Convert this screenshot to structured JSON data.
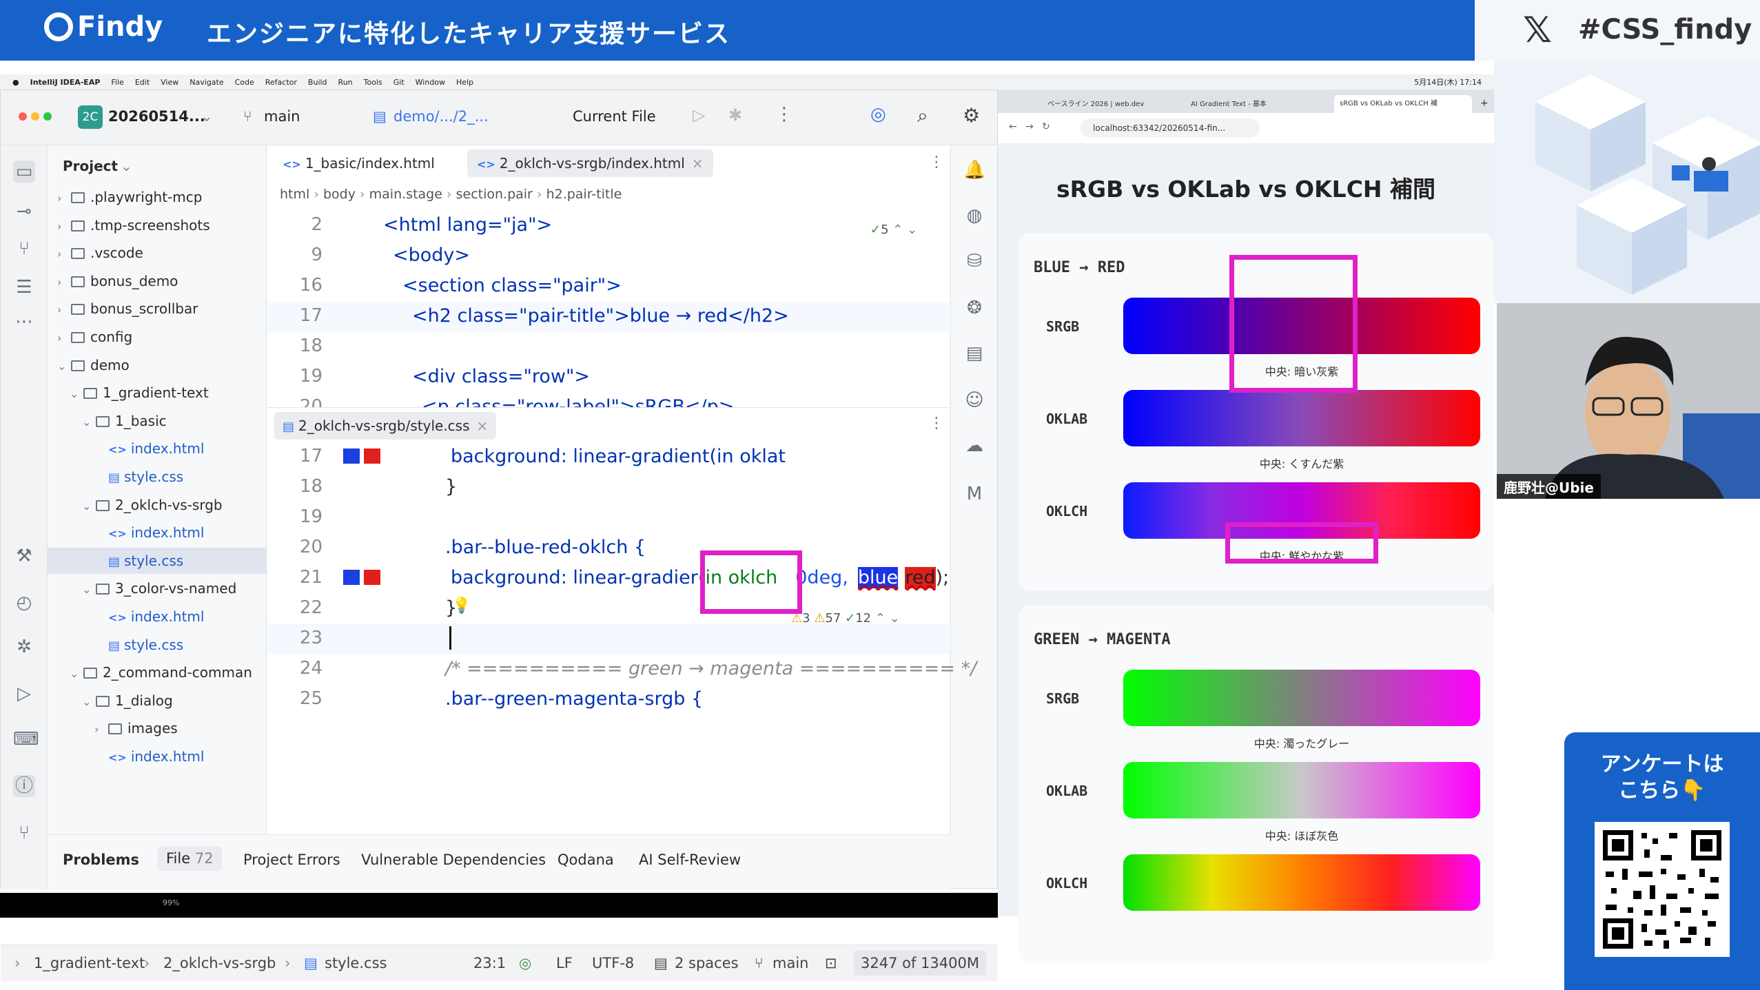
{
  "banner": {
    "brand": "Findy",
    "title": "エンジニアに特化したキャリア支援サービス",
    "hashtag": "#CSS_findy"
  },
  "mac_menu": {
    "app": "IntelliJ IDEA-EAP",
    "items": [
      "File",
      "Edit",
      "View",
      "Navigate",
      "Code",
      "Refactor",
      "Build",
      "Run",
      "Tools",
      "Git",
      "Window",
      "Help"
    ],
    "clock": "5月14日(木) 17:14"
  },
  "ide": {
    "project_badge": "2C",
    "project_name": "20260514...",
    "branch": "main",
    "path": "demo/.../2_...",
    "run_config": "Current File",
    "project_panel_title": "Project",
    "tree": [
      {
        "label": ".playwright-mcp",
        "type": "folder",
        "level": 0,
        "open": false
      },
      {
        "label": ".tmp-screenshots",
        "type": "folder",
        "level": 0,
        "open": false
      },
      {
        "label": ".vscode",
        "type": "folder",
        "level": 0,
        "open": false
      },
      {
        "label": "bonus_demo",
        "type": "folder",
        "level": 0,
        "open": false
      },
      {
        "label": "bonus_scrollbar",
        "type": "folder",
        "level": 0,
        "open": false
      },
      {
        "label": "config",
        "type": "folder",
        "level": 0,
        "open": false
      },
      {
        "label": "demo",
        "type": "folder",
        "level": 0,
        "open": true
      },
      {
        "label": "1_gradient-text",
        "type": "folder",
        "level": 1,
        "open": true
      },
      {
        "label": "1_basic",
        "type": "folder",
        "level": 2,
        "open": true
      },
      {
        "label": "index.html",
        "type": "html",
        "level": 3
      },
      {
        "label": "style.css",
        "type": "css",
        "level": 3
      },
      {
        "label": "2_oklch-vs-srgb",
        "type": "folder",
        "level": 2,
        "open": true
      },
      {
        "label": "index.html",
        "type": "html",
        "level": 3
      },
      {
        "label": "style.css",
        "type": "css",
        "level": 3,
        "selected": true
      },
      {
        "label": "3_color-vs-named",
        "type": "folder",
        "level": 2,
        "open": true
      },
      {
        "label": "index.html",
        "type": "html",
        "level": 3
      },
      {
        "label": "style.css",
        "type": "css",
        "level": 3
      },
      {
        "label": "2_command-comman",
        "type": "folder",
        "level": 1,
        "open": true
      },
      {
        "label": "1_dialog",
        "type": "folder",
        "level": 2,
        "open": true
      },
      {
        "label": "images",
        "type": "folder",
        "level": 3,
        "open": false
      },
      {
        "label": "index.html",
        "type": "html",
        "level": 3
      }
    ],
    "tabs_top": [
      "1_basic/index.html",
      "2_oklch-vs-srgb/index.html"
    ],
    "breadcrumb": [
      "html",
      "body",
      "main.stage",
      "section.pair",
      "h2.pair-title"
    ],
    "inspection_top": "5",
    "html_lines": [
      {
        "n": "2",
        "code": "<html lang=\"ja\">"
      },
      {
        "n": "9",
        "code": "<body>"
      },
      {
        "n": "16",
        "code": "<section class=\"pair\">"
      },
      {
        "n": "17",
        "code": "<h2 class=\"pair-title\">blue → red</h2>"
      },
      {
        "n": "18",
        "code": ""
      },
      {
        "n": "19",
        "code": "<div class=\"row\">"
      },
      {
        "n": "20",
        "code": "<p class=\"row-label\">sRGB</p>"
      }
    ],
    "tab_bottom": "2_oklch-vs-srgb/style.css",
    "inspections_bottom": {
      "warn": "3",
      "weak": "57",
      "ok": "12"
    },
    "css_lines": [
      {
        "n": "17",
        "code": "background: linear-gradient(in oklat"
      },
      {
        "n": "18",
        "code": "}"
      },
      {
        "n": "19",
        "code": ""
      },
      {
        "n": "20",
        "code": ".bar--blue-red-oklch {"
      },
      {
        "n": "21",
        "code_a": "background: linear-gradier",
        "code_hl": "(in oklch",
        "code_b": "0deg,",
        "code_blue": "blue",
        "code_red": "red",
        "code_end": ");"
      },
      {
        "n": "22",
        "code": "}"
      },
      {
        "n": "23",
        "code": ""
      },
      {
        "n": "24",
        "code": "/* ========== green → magenta ========== */"
      },
      {
        "n": "25",
        "code": ".bar--green-magenta-srgb {"
      }
    ],
    "bottom_tabs": {
      "problems": "Problems",
      "file": "File",
      "file_count": "72",
      "project_errors": "Project Errors",
      "vuln": "Vulnerable Dependencies",
      "qodana": "Qodana",
      "ai": "AI Self-Review"
    },
    "status": {
      "crumb": [
        "1_gradient-text",
        "2_oklch-vs-srgb",
        "style.css"
      ],
      "pos": "23:1",
      "le": "LF",
      "enc": "UTF-8",
      "indent": "2 spaces",
      "branch": "main",
      "mem": "3247 of 13400M"
    },
    "zoom": "99%"
  },
  "browser": {
    "tabs": [
      "ベースライン 2026 | web.dev",
      "AI Gradient Text - 基本",
      "sRGB vs OKLab vs OKLCH 補"
    ],
    "url": "localhost:63342/20260514-fin...",
    "page_title": "sRGB vs OKLab vs OKLCH 補間",
    "sections": [
      {
        "title": "BLUE → RED",
        "rows": [
          {
            "label": "SRGB",
            "caption": "中央: 暗い灰紫",
            "gradient": "linear-gradient(90deg,#0000ff,#7f007f,#ff0000)"
          },
          {
            "label": "OKLAB",
            "caption": "中央: くすんだ紫",
            "gradient": "linear-gradient(90deg,#0000ff,#8a4bb8,#ff0000)"
          },
          {
            "label": "OKLCH",
            "caption": "中央: 鮮やかな紫",
            "gradient": "linear-gradient(90deg,#0a1cff,#8a2be2,#c000e0,#ff2050,#ff0000)"
          }
        ]
      },
      {
        "title": "GREEN → MAGENTA",
        "rows": [
          {
            "label": "SRGB",
            "caption": "中央: 濁ったグレー",
            "gradient": "linear-gradient(90deg,#00ff00,#808080,#ff00ff)"
          },
          {
            "label": "OKLAB",
            "caption": "中央: ほぼ灰色",
            "gradient": "linear-gradient(90deg,#00ff00,#c8c8c8,#ff00ff)"
          },
          {
            "label": "OKLCH",
            "caption": "",
            "gradient": "linear-gradient(90deg,#00e000,#e8e000,#ff8000,#ff2020,#ff00ff)"
          }
        ]
      }
    ]
  },
  "speaker": {
    "name": "鹿野壮@Ubie"
  },
  "survey": {
    "text": "アンケートは\nこちら👇"
  }
}
